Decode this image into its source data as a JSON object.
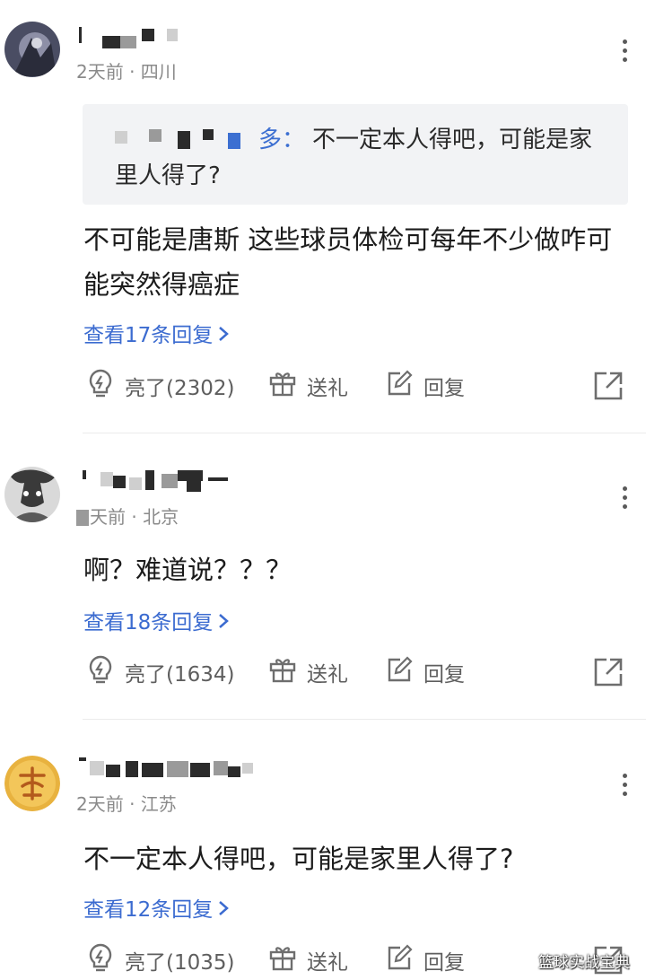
{
  "comments": [
    {
      "meta": "2天前 · 四川",
      "quote": {
        "name": "多：",
        "text": "不一定本人得吧，可能是家里人得了?"
      },
      "text": "不可能是唐斯 这些球员体检可每年不少做咋可能突然得癌症",
      "replies": "查看17条回复",
      "likes": "亮了(2302)",
      "gift": "送礼",
      "reply": "回复"
    },
    {
      "meta": "天前 · 北京",
      "text": "啊？难道说？？？",
      "replies": "查看18条回复",
      "likes": "亮了(1634)",
      "gift": "送礼",
      "reply": "回复"
    },
    {
      "meta": "2天前 · 江苏",
      "text": "不一定本人得吧，可能是家里人得了?",
      "replies": "查看12条回复",
      "likes": "亮了(1035)",
      "gift": "送礼",
      "reply": "回复"
    }
  ],
  "icons": {
    "like": "lightbulb-icon",
    "gift": "gift-icon",
    "reply": "edit-icon",
    "share": "share-icon",
    "more": "more-vertical-icon",
    "chevron": "chevron-right-icon"
  },
  "colors": {
    "link": "#3b6bd0",
    "meta": "#8a8a8a",
    "quote_bg": "#f2f3f5"
  },
  "watermark": "篮球实战宝典"
}
